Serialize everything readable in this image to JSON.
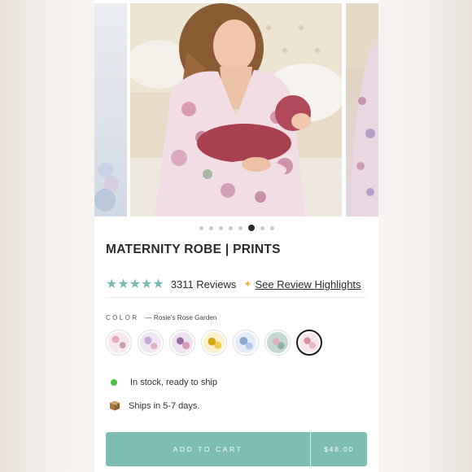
{
  "product": {
    "title": "MATERNITY ROBE | PRINTS",
    "rating_stars": "★★★★★",
    "review_count": "3311 Reviews",
    "review_highlights_link": "See Review Highlights",
    "color_label": "COLOR",
    "color_value": "— Rosie's Rose Garden",
    "swatches": [
      {
        "name": "pink-floral",
        "color": "#efd9de"
      },
      {
        "name": "lavender-floral",
        "color": "#d9cfe4"
      },
      {
        "name": "purple-floral",
        "color": "#d8c4dd"
      },
      {
        "name": "sunflower",
        "color": "#f1e3a6"
      },
      {
        "name": "blue-floral",
        "color": "#c9d6ea"
      },
      {
        "name": "sage-floral",
        "color": "#b7cbc5"
      },
      {
        "name": "rosies-rose-garden",
        "color": "#ecd3d6",
        "selected": true
      }
    ],
    "stock_status": "In stock, ready to ship",
    "shipping": "Ships in 5-7 days.",
    "add_to_cart": "ADD TO CART",
    "price": "$48.00"
  },
  "gallery": {
    "slide_count": 8,
    "active_index": 5
  },
  "colors": {
    "accent": "#7dbdb4",
    "stars": "#7bbab3",
    "stock": "#4cbf4a",
    "sparkle": "#e5b93a"
  }
}
